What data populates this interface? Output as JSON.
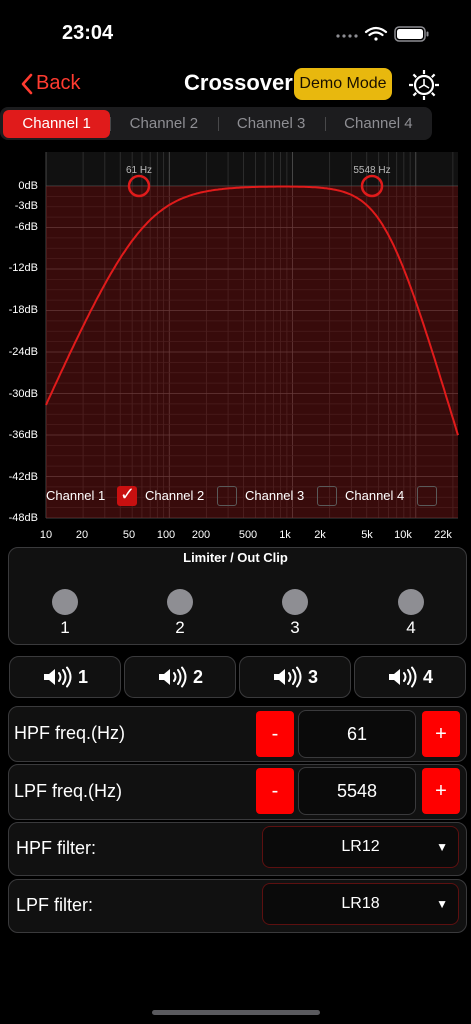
{
  "status": {
    "time": "23:04"
  },
  "nav": {
    "back_label": "Back",
    "title": "Crossover",
    "demo_label": "Demo Mode"
  },
  "tabs": [
    {
      "label": "Channel 1",
      "active": true
    },
    {
      "label": "Channel 2",
      "active": false
    },
    {
      "label": "Channel 3",
      "active": false
    },
    {
      "label": "Channel 4",
      "active": false
    }
  ],
  "graph": {
    "hpf_marker": "61 Hz",
    "lpf_marker": "5548 Hz",
    "y_labels": [
      "0dB",
      "-3dB",
      "-6dB",
      "-12dB",
      "-18dB",
      "-24dB",
      "-30dB",
      "-36dB",
      "-42dB",
      "-48dB"
    ],
    "x_labels": [
      "10",
      "20",
      "50",
      "100",
      "200",
      "500",
      "1k",
      "2k",
      "5k",
      "10k",
      "22k"
    ],
    "channels": [
      {
        "label": "Channel 1",
        "checked": true
      },
      {
        "label": "Channel 2",
        "checked": false
      },
      {
        "label": "Channel 3",
        "checked": false
      },
      {
        "label": "Channel 4",
        "checked": false
      }
    ],
    "curve_color": "#e01b1b"
  },
  "limiter": {
    "title": "Limiter / Out Clip",
    "leds": [
      "1",
      "2",
      "3",
      "4"
    ]
  },
  "speakers": [
    "1",
    "2",
    "3",
    "4"
  ],
  "hpf_freq": {
    "label": "HPF freq.(Hz)",
    "value": "61",
    "minus": "-",
    "plus": "+"
  },
  "lpf_freq": {
    "label": "LPF freq.(Hz)",
    "value": "5548",
    "minus": "-",
    "plus": "+"
  },
  "hpf_filter": {
    "label": "HPF filter:",
    "value": "LR12"
  },
  "lpf_filter": {
    "label": "LPF filter:",
    "value": "LR18"
  },
  "colors": {
    "accent": "#e01b1b",
    "demo": "#e8b80e",
    "plusminus": "#ff0000"
  }
}
